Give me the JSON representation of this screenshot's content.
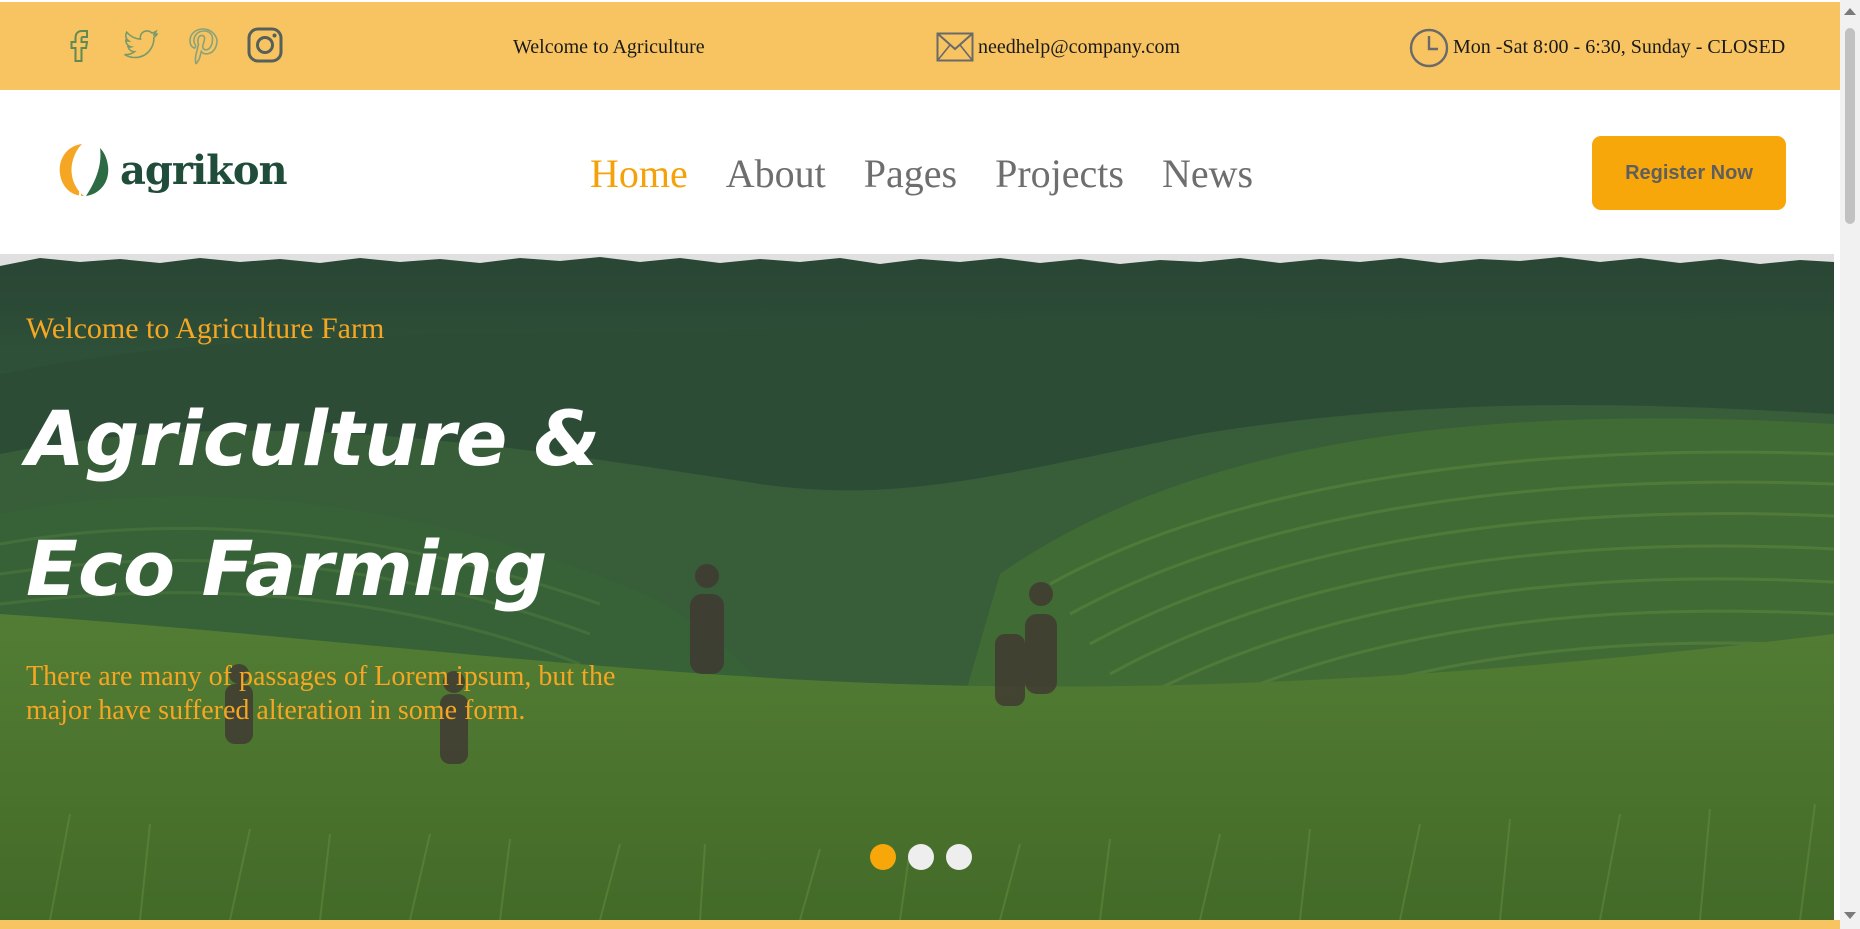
{
  "topbar": {
    "social": [
      {
        "icon": "facebook-icon"
      },
      {
        "icon": "twitter-icon"
      },
      {
        "icon": "pinterest-icon"
      },
      {
        "icon": "instagram-icon"
      }
    ],
    "welcome": "Welcome to Agriculture",
    "email": "needhelp@company.com",
    "hours": "Mon -Sat 8:00 - 6:30, Sunday - CLOSED",
    "background": "#f7c461"
  },
  "header": {
    "logo_text": "agrikon",
    "nav": [
      {
        "label": "Home",
        "active": true
      },
      {
        "label": "About",
        "active": false
      },
      {
        "label": "Pages",
        "active": false
      },
      {
        "label": "Projects",
        "active": false
      },
      {
        "label": "News",
        "active": false
      }
    ],
    "register_label": "Register Now",
    "accent": "#f7a70a"
  },
  "hero": {
    "subtitle": "Welcome to Agriculture Farm",
    "title": "Agriculture & Eco Farming",
    "description": "There are many of passages of Lorem ipsum, but the major have suffered alteration in some form.",
    "slides": [
      {
        "active": true
      },
      {
        "active": false
      },
      {
        "active": false
      }
    ]
  }
}
